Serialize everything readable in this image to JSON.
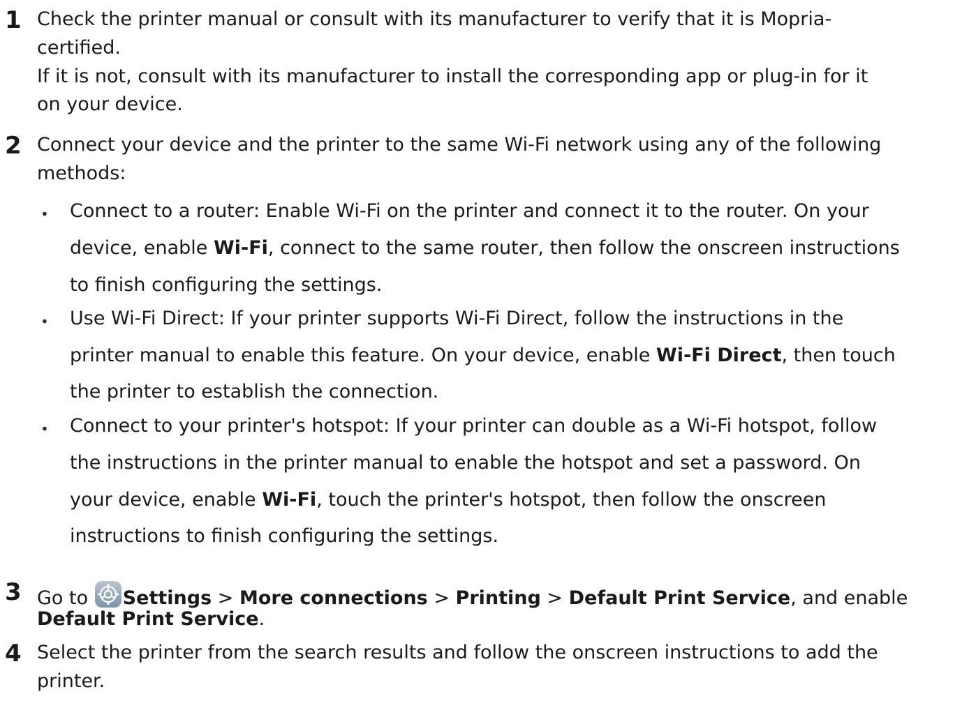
{
  "steps": [
    {
      "number": "1",
      "lines": [
        "Check the printer manual or consult with its manufacturer to verify that it is Mopria-",
        "certified.",
        "If it is not, consult with its manufacturer to install the corresponding app or plug-in for it",
        "on your device."
      ]
    },
    {
      "number": "2",
      "lines": [
        "Connect your device and the printer to the same Wi-Fi network using any of the following",
        "methods:"
      ],
      "bullets": [
        {
          "lines": [
            {
              "parts": [
                "Connect to a router: Enable Wi-Fi on the printer and connect it to the router. On your"
              ]
            },
            {
              "parts": [
                "device, enable ",
                "Wi-Fi",
                ", connect to the same router, then follow the onscreen instructions"
              ]
            },
            {
              "parts": [
                "to finish configuring the settings."
              ]
            }
          ]
        },
        {
          "lines": [
            {
              "parts": [
                "Use Wi-Fi Direct: If your printer supports Wi-Fi Direct, follow the instructions in the"
              ]
            },
            {
              "parts": [
                "printer manual to enable this feature. On your device, enable ",
                "Wi-Fi Direct",
                ", then touch"
              ]
            },
            {
              "parts": [
                "the printer to establish the connection."
              ]
            }
          ]
        },
        {
          "lines": [
            {
              "parts": [
                "Connect to your printer's hotspot: If your printer can double as a Wi-Fi hotspot, follow"
              ]
            },
            {
              "parts": [
                "the instructions in the printer manual to enable the hotspot and set a password. On"
              ]
            },
            {
              "parts": [
                "your device, enable ",
                "Wi-Fi",
                ", touch the printer's hotspot, then follow the onscreen"
              ]
            },
            {
              "parts": [
                "instructions to finish configuring the settings."
              ]
            }
          ]
        }
      ]
    },
    {
      "number": "3",
      "icon": "settings-gear-icon",
      "line1": {
        "goto": "Go to ",
        "settings": "Settings",
        "sep1": " > ",
        "more": "More connections",
        "sep2": " > ",
        "printing": "Printing",
        "sep3": " > ",
        "dps": "Default Print Service",
        "tail": ", and enable"
      },
      "line2": {
        "dps": "Default Print Service",
        "tail": "."
      }
    },
    {
      "number": "4",
      "lines": [
        "Select the printer from the search results and follow the onscreen instructions to add the",
        "printer."
      ]
    }
  ],
  "bullet_glyph": "•",
  "colors": {
    "text": "#1a1a1a",
    "icon_bg": "#8fa3b3",
    "icon_fg": "#ffffff"
  }
}
